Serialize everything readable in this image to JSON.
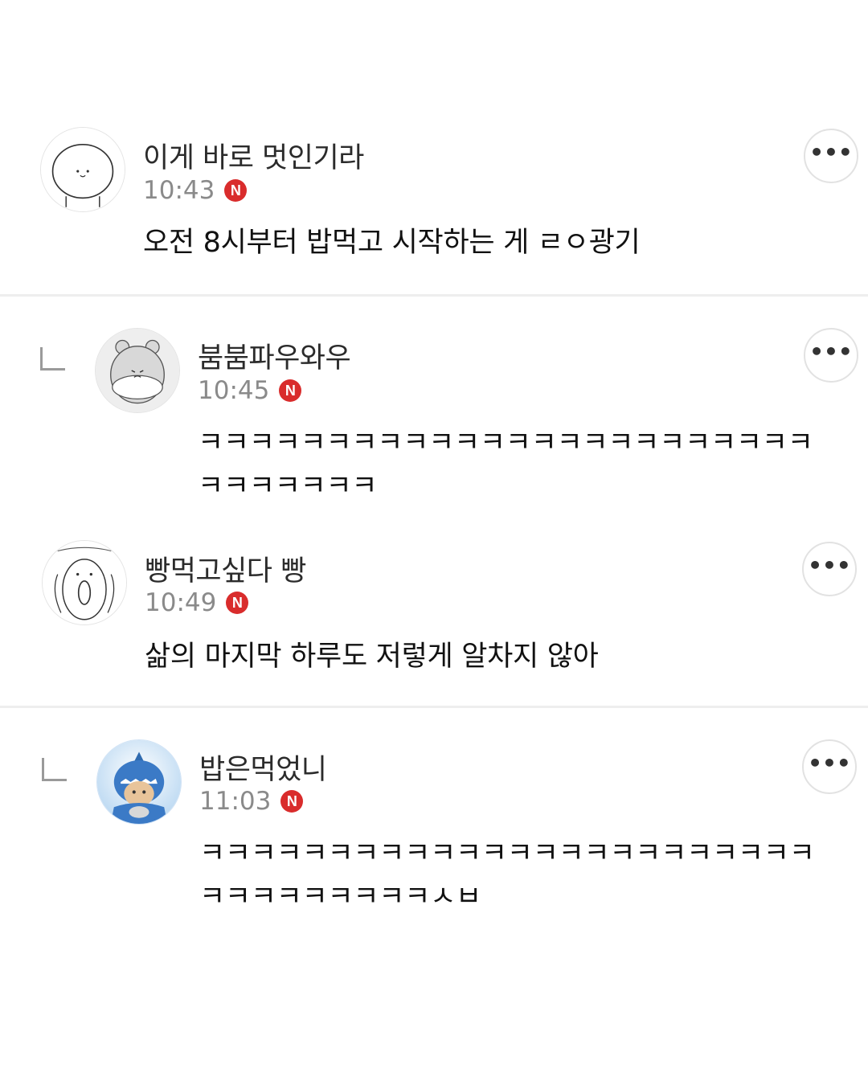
{
  "comments": [
    {
      "author": "이게 바로 멋인기라",
      "time": "10:43",
      "badge": "N",
      "text": "오전 8시부터 밥먹고 시작하는 게 ㄹㅇ광기",
      "more_icon": "more-horizontal-icon",
      "is_reply": false
    },
    {
      "author": "붐붐파우와우",
      "time": "10:45",
      "badge": "N",
      "text_lines": [
        "ㅋㅋㅋㅋㅋㅋㅋㅋㅋㅋㅋㅋㅋㅋㅋㅋㅋㅋㅋㅋㅋㅋㅋㅋ",
        "ㅋㅋㅋㅋㅋㅋㅋ"
      ],
      "more_icon": "more-horizontal-icon",
      "is_reply": true
    },
    {
      "author": "빵먹고싶다 빵",
      "time": "10:49",
      "badge": "N",
      "text": "삶의 마지막 하루도 저렇게 알차지 않아",
      "more_icon": "more-horizontal-icon",
      "is_reply": false
    },
    {
      "author": "밥은먹었니",
      "time": "11:03",
      "badge": "N",
      "text_lines": [
        "ㅋㅋㅋㅋㅋㅋㅋㅋㅋㅋㅋㅋㅋㅋㅋㅋㅋㅋㅋㅋㅋㅋㅋㅋ",
        "ㅋㅋㅋㅋㅋㅋㅋㅋㅋㅅㅂ"
      ],
      "more_icon": "more-horizontal-icon",
      "is_reply": true
    }
  ],
  "colors": {
    "badge": "#d92c2c",
    "divider": "#eeeeee",
    "time": "#8a8a8a"
  }
}
